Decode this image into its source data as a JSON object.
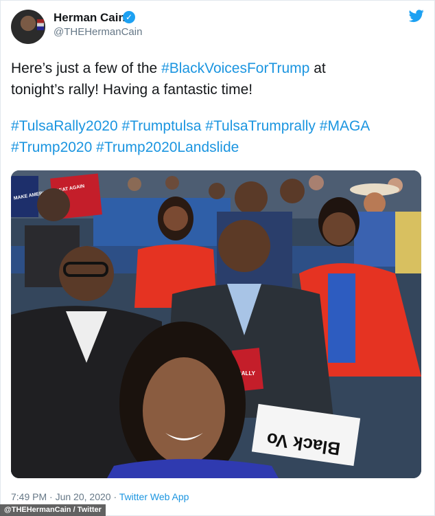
{
  "author": {
    "name": "Herman Cain",
    "handle": "@THEHermanCain",
    "verified_badge": "✓",
    "avatar_icon": "profile-photo"
  },
  "tweet": {
    "line1_pre": "Here’s just a few of the ",
    "line1_tag": "#BlackVoicesForTrump",
    "line1_post": " at",
    "line2": "tonight’s rally!  Having a fantastic time!",
    "hashtags_line1": [
      "#TulsaRally2020",
      "#Trumptulsa",
      "#TulsaTrumprally",
      "#MAGA"
    ],
    "hashtags_line2": [
      "#Trump2020",
      "#Trump2020Landslide"
    ]
  },
  "photo": {
    "sign_left": "MAKE AMERICA GREAT AGAIN",
    "sign_right": "Black Vo",
    "badge": "RALLY"
  },
  "meta": {
    "time": "7:49 PM",
    "date": "Jun 20, 2020",
    "separator": "·",
    "app": "Twitter Web App"
  },
  "credit": "@THEHermanCain / Twitter",
  "colors": {
    "link": "#1b95e0",
    "verified": "#1da1f2",
    "secondary_text": "#657786"
  }
}
